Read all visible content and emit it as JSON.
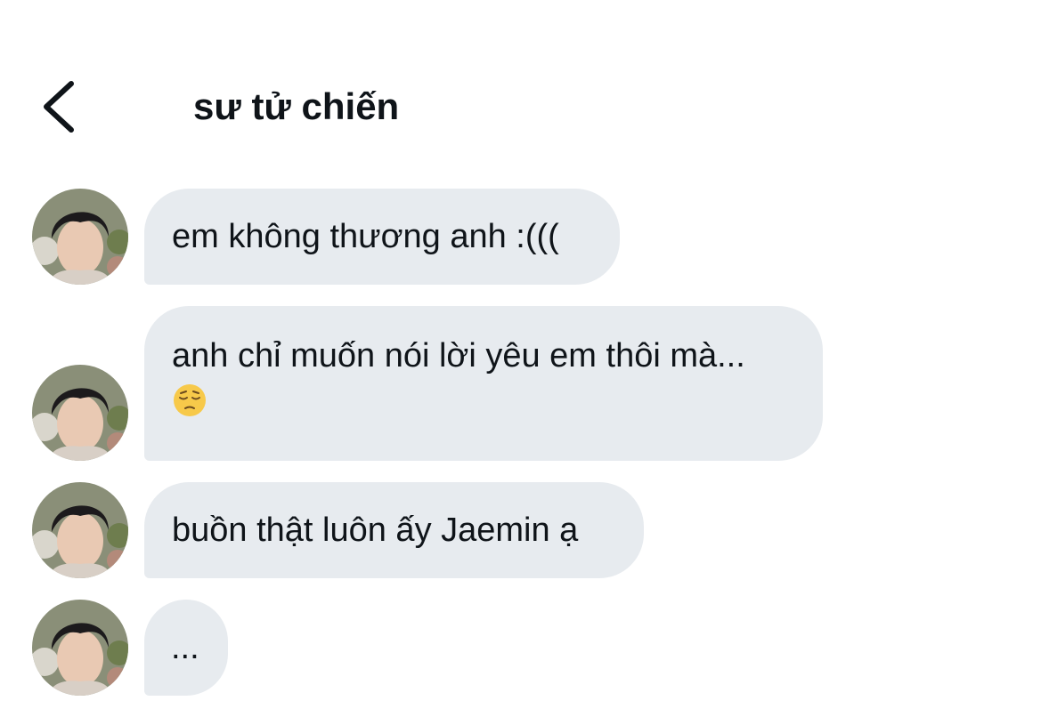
{
  "header": {
    "title": "sư tử chiến",
    "back_icon": "chevron-left-icon"
  },
  "messages": [
    {
      "text": "em không thương anh :((("
    },
    {
      "text": "anh chỉ muốn nói lời yêu em thôi mà...",
      "emoji": "pensive-face-emoji"
    },
    {
      "text": "buồn thật luôn ấy Jaemin ạ"
    },
    {
      "text": "..."
    }
  ],
  "colors": {
    "bubble_bg": "#e7ebef",
    "text": "#0f1419",
    "background": "#ffffff"
  }
}
